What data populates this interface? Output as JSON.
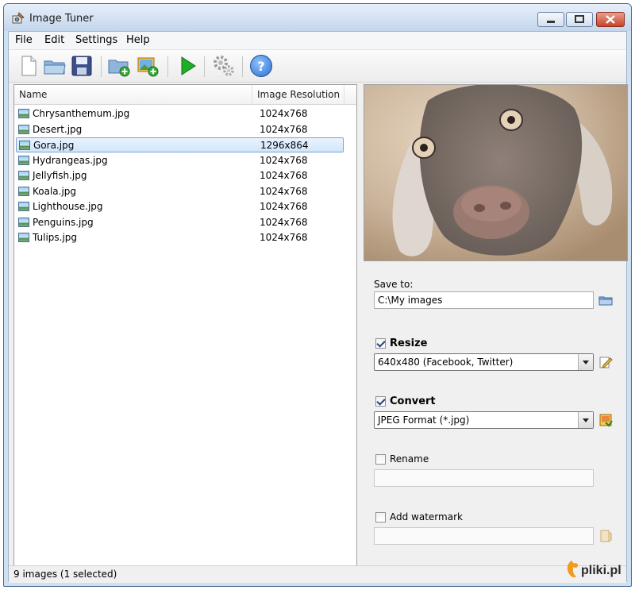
{
  "window": {
    "title": "Image Tuner"
  },
  "menu": [
    "File",
    "Edit",
    "Settings",
    "Help"
  ],
  "toolbar": {
    "icons": [
      "new-file-icon",
      "open-folder-icon",
      "save-icon",
      "add-folder-icon",
      "add-image-icon",
      "run-icon",
      "settings-gears-icon",
      "help-icon"
    ],
    "help_glyph": "?"
  },
  "list": {
    "columns": [
      "Name",
      "Image Resolution"
    ],
    "files": [
      {
        "name": "Chrysanthemum.jpg",
        "res": "1024x768"
      },
      {
        "name": "Desert.jpg",
        "res": "1024x768"
      },
      {
        "name": "Gora.jpg",
        "res": "1296x864",
        "selected": true
      },
      {
        "name": "Hydrangeas.jpg",
        "res": "1024x768"
      },
      {
        "name": "Jellyfish.jpg",
        "res": "1024x768"
      },
      {
        "name": "Koala.jpg",
        "res": "1024x768"
      },
      {
        "name": "Lighthouse.jpg",
        "res": "1024x768"
      },
      {
        "name": "Penguins.jpg",
        "res": "1024x768"
      },
      {
        "name": "Tulips.jpg",
        "res": "1024x768"
      }
    ]
  },
  "save": {
    "label": "Save to:",
    "path": "C:\\My images"
  },
  "resize": {
    "label": "Resize",
    "checked": true,
    "value": "640x480 (Facebook, Twitter)"
  },
  "convert": {
    "label": "Convert",
    "checked": true,
    "value": "JPEG Format (*.jpg)"
  },
  "rename": {
    "label": "Rename",
    "checked": false,
    "value": ""
  },
  "watermark": {
    "label": "Add watermark",
    "checked": false,
    "value": ""
  },
  "status": "9 images (1 selected)",
  "brand": {
    "logo_text": "pliki.pl"
  },
  "colors": {
    "selection": "#d1e6fb",
    "accent": "#1a9d2b",
    "help": "#3a7fd6"
  }
}
